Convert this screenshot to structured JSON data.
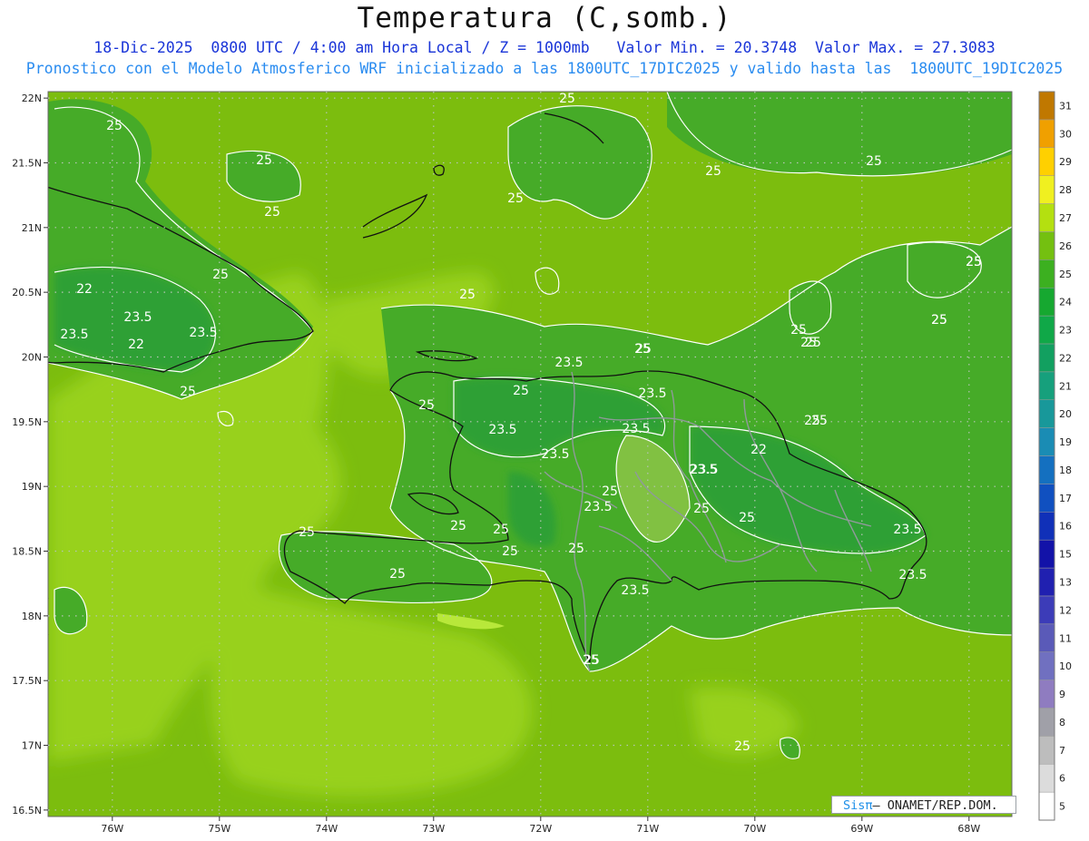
{
  "title": "Temperatura (C,somb.)",
  "subtitle_line1": "18-Dic-2025  0800 UTC / 4:00 am Hora Local / Z = 1000mb   Valor Min. = 20.3748  Valor Max. = 27.3083",
  "subtitle_line2": "Pronostico con el Modelo Atmosferico WRF inicializado a las 1800UTC_17DIC2025 y valido hasta las  1800UTC_19DIC2025",
  "credit": {
    "prefix": "Sis",
    "pi": "π",
    "text": "– ONAMET/REP.DOM."
  },
  "axes": {
    "lat_labels": [
      "22N",
      "21.5N",
      "21N",
      "20.5N",
      "20N",
      "19.5N",
      "19N",
      "18.5N",
      "18N",
      "17.5N",
      "17N",
      "16.5N"
    ],
    "lon_labels": [
      "76W",
      "75W",
      "74W",
      "73W",
      "72W",
      "71W",
      "70W",
      "69W",
      "68W"
    ],
    "lat_min": 16.5,
    "lat_max": 22.0,
    "lon_min": -76.6,
    "lon_max": -67.6,
    "grid": "dotted"
  },
  "colorbar": {
    "labels": [
      "5",
      "6",
      "7",
      "8",
      "9",
      "10",
      "11",
      "12",
      "13",
      "15",
      "16",
      "17",
      "18",
      "19",
      "20",
      "21",
      "22",
      "23",
      "24",
      "25",
      "26",
      "27",
      "28",
      "29",
      "30",
      "31"
    ],
    "colors": [
      "#ffffff",
      "#dcdcdc",
      "#bdbdbd",
      "#a0a0a8",
      "#8f7cc0",
      "#7070c0",
      "#5a5ab8",
      "#3c3cb8",
      "#2020b0",
      "#1212a8",
      "#1030b8",
      "#1050c0",
      "#1470c0",
      "#1a8cb4",
      "#18989a",
      "#16a07c",
      "#12a060",
      "#10a848",
      "#16a830",
      "#3cb020",
      "#74c010",
      "#b4e010",
      "#f0f020",
      "#ffd000",
      "#f0a000",
      "#c07800"
    ]
  },
  "contour_labels": [
    "25",
    "25",
    "25",
    "25",
    "25",
    "25",
    "25",
    "25",
    "25",
    "22",
    "23.5",
    "23.5",
    "22",
    "23.5",
    "23.5",
    "25",
    "25",
    "25",
    "25",
    "25",
    "25",
    "25",
    "25",
    "25",
    "23.5",
    "23.5",
    "23.5",
    "23.5",
    "22",
    "23.5",
    "23.5",
    "25",
    "25",
    "25",
    "25",
    "23.5",
    "23.5",
    "25",
    "25",
    "25",
    "25",
    "25",
    "23.5",
    "25",
    "25",
    "25",
    "25",
    "25",
    "23.5",
    "25",
    "25",
    "25"
  ],
  "colors": {
    "shade_low": "#9ad21c",
    "shade_mid": "#7cbd0e",
    "shade_high": "#46ab28",
    "shade_top": "#2ea034",
    "contour": "#ffffff"
  }
}
